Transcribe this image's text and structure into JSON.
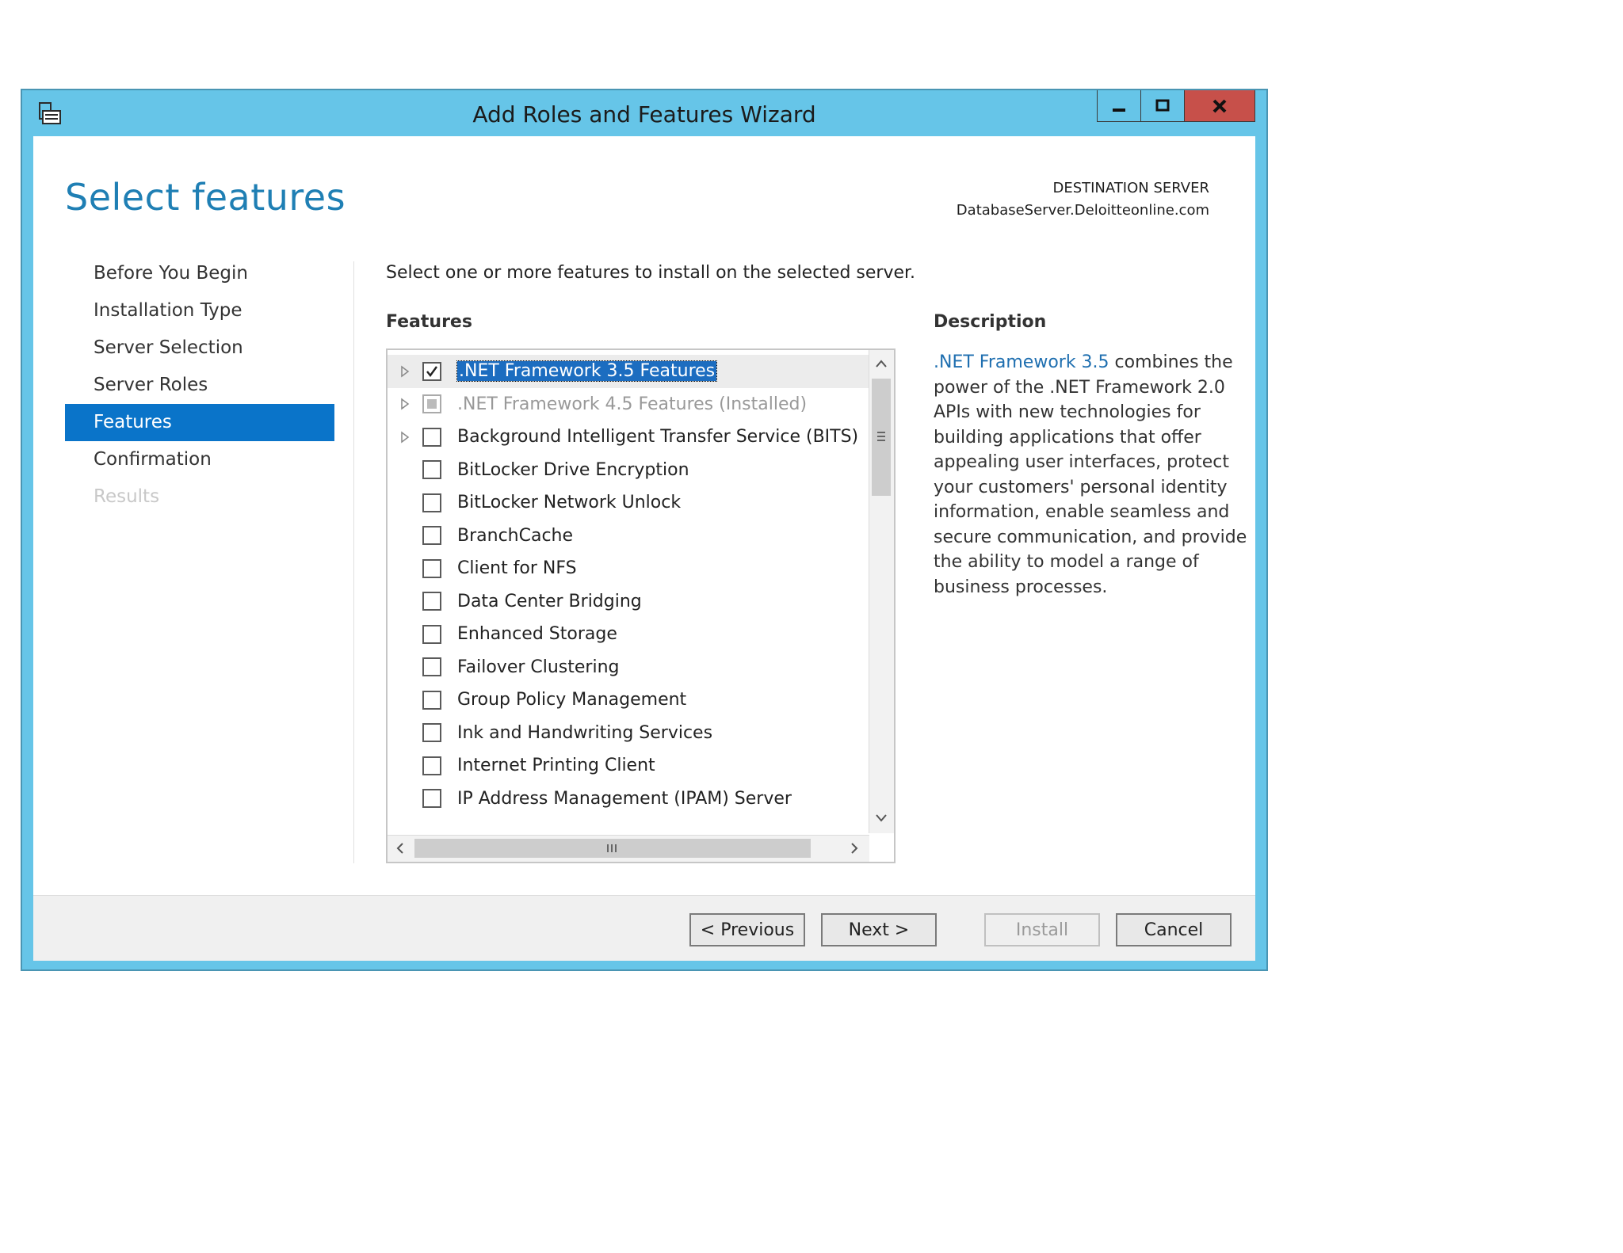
{
  "window": {
    "title": "Add Roles and Features Wizard",
    "icon": "server-manager-icon",
    "controls": [
      "minimize-icon",
      "maximize-icon",
      "close-icon"
    ]
  },
  "page": {
    "title": "Select features",
    "destination_label": "DESTINATION SERVER",
    "destination_server": "DatabaseServer.Deloitteonline.com"
  },
  "nav": {
    "items": [
      {
        "label": "Before You Begin",
        "state": "normal"
      },
      {
        "label": "Installation Type",
        "state": "normal"
      },
      {
        "label": "Server Selection",
        "state": "normal"
      },
      {
        "label": "Server Roles",
        "state": "normal"
      },
      {
        "label": "Features",
        "state": "active"
      },
      {
        "label": "Confirmation",
        "state": "normal"
      },
      {
        "label": "Results",
        "state": "disabled"
      }
    ]
  },
  "main": {
    "intro": "Select one or more features to install on the selected server.",
    "features_heading": "Features",
    "features": [
      {
        "label": ".NET Framework 3.5 Features",
        "checked": true,
        "expandable": true,
        "selected": true
      },
      {
        "label": ".NET Framework 4.5 Features (Installed)",
        "checked": "partial",
        "expandable": true,
        "dim": true
      },
      {
        "label": "Background Intelligent Transfer Service (BITS)",
        "checked": false,
        "expandable": true
      },
      {
        "label": "BitLocker Drive Encryption",
        "checked": false
      },
      {
        "label": "BitLocker Network Unlock",
        "checked": false
      },
      {
        "label": "BranchCache",
        "checked": false
      },
      {
        "label": "Client for NFS",
        "checked": false
      },
      {
        "label": "Data Center Bridging",
        "checked": false
      },
      {
        "label": "Enhanced Storage",
        "checked": false
      },
      {
        "label": "Failover Clustering",
        "checked": false
      },
      {
        "label": "Group Policy Management",
        "checked": false
      },
      {
        "label": "Ink and Handwriting Services",
        "checked": false
      },
      {
        "label": "Internet Printing Client",
        "checked": false
      },
      {
        "label": "IP Address Management (IPAM) Server",
        "checked": false
      }
    ],
    "description_heading": "Description",
    "description_link": ".NET Framework 3.5",
    "description_text": " combines the power of the .NET Framework 2.0 APIs with new technologies for building applications that offer appealing user interfaces, protect your customers' personal identity information, enable seamless and secure communication, and provide the ability to model a range of business processes."
  },
  "footer": {
    "previous": "< Previous",
    "next": "Next >",
    "install": "Install",
    "cancel": "Cancel"
  },
  "colors": {
    "frame": "#66c5e8",
    "close_button": "#c7504a",
    "accent": "#0a74c9",
    "title_text": "#1f7fb4"
  }
}
